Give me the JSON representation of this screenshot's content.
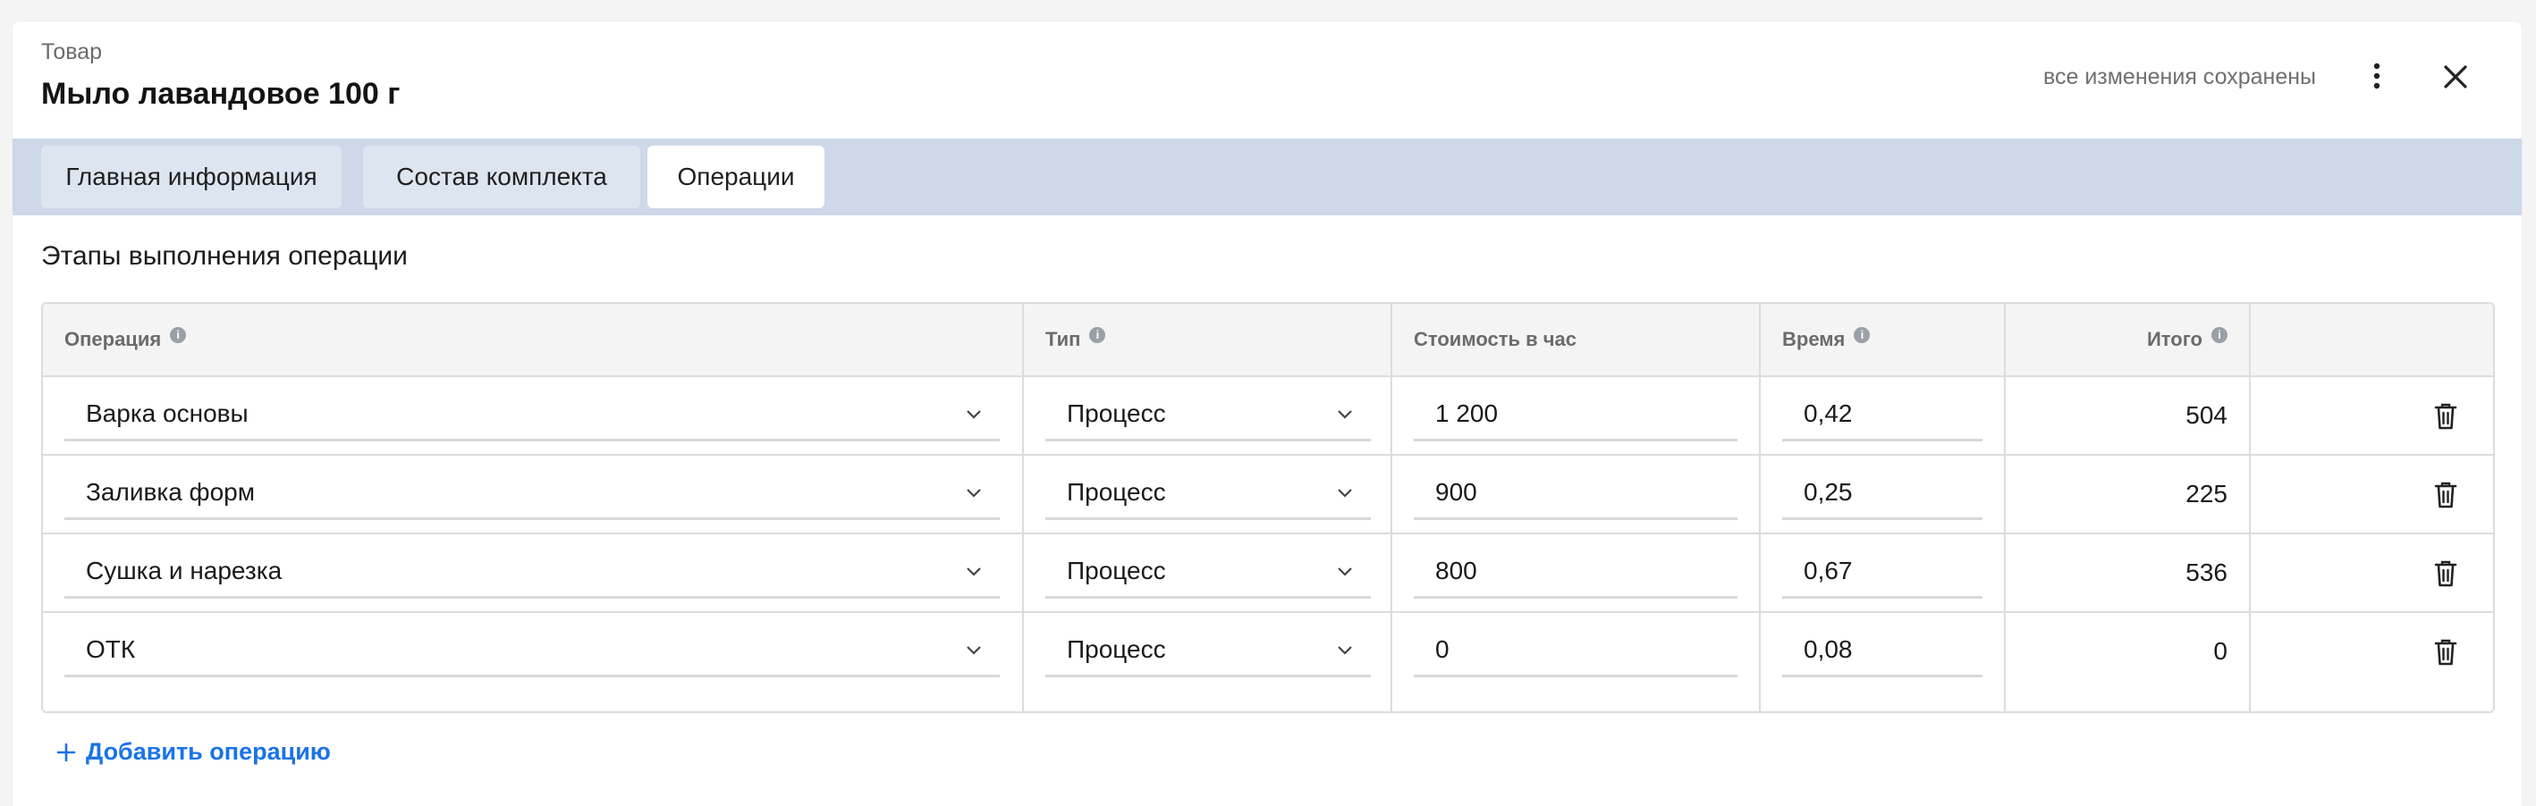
{
  "header": {
    "subtitle": "Товар",
    "title": "Мыло лавандовое 100 г",
    "save_status": "все изменения сохранены"
  },
  "tabs": [
    {
      "label": "Главная информация",
      "active": false
    },
    {
      "label": "Состав комплекта",
      "active": false
    },
    {
      "label": "Операции",
      "active": true
    }
  ],
  "section": {
    "title": "Этапы выполнения операции"
  },
  "table": {
    "columns": {
      "operation": "Операция",
      "type": "Тип",
      "cost_per_hour": "Стоимость в час",
      "time": "Время",
      "total": "Итого"
    },
    "info_marker": "i",
    "rows": [
      {
        "operation": "Варка основы",
        "type": "Процесс",
        "cost": "1 200",
        "time": "0,42",
        "total": "504"
      },
      {
        "operation": "Заливка форм",
        "type": "Процесс",
        "cost": "900",
        "time": "0,25",
        "total": "225"
      },
      {
        "operation": "Сушка и нарезка",
        "type": "Процесс",
        "cost": "800",
        "time": "0,67",
        "total": "536"
      },
      {
        "operation": "ОТК",
        "type": "Процесс",
        "cost": "0",
        "time": "0,08",
        "total": "0"
      }
    ]
  },
  "actions": {
    "add_operation": "Добавить операцию"
  },
  "icons": {
    "more": "more-vertical-icon",
    "close": "close-icon",
    "info": "info-icon",
    "chevron": "chevron-down-icon",
    "delete": "trash-icon",
    "add": "plus-icon"
  },
  "colors": {
    "tabbar_bg": "#cdd8e8",
    "tab_bg": "#dde5f0",
    "tab_active_bg": "#ffffff",
    "accent": "#1a73e8",
    "header_bg": "#f4f4f4"
  }
}
